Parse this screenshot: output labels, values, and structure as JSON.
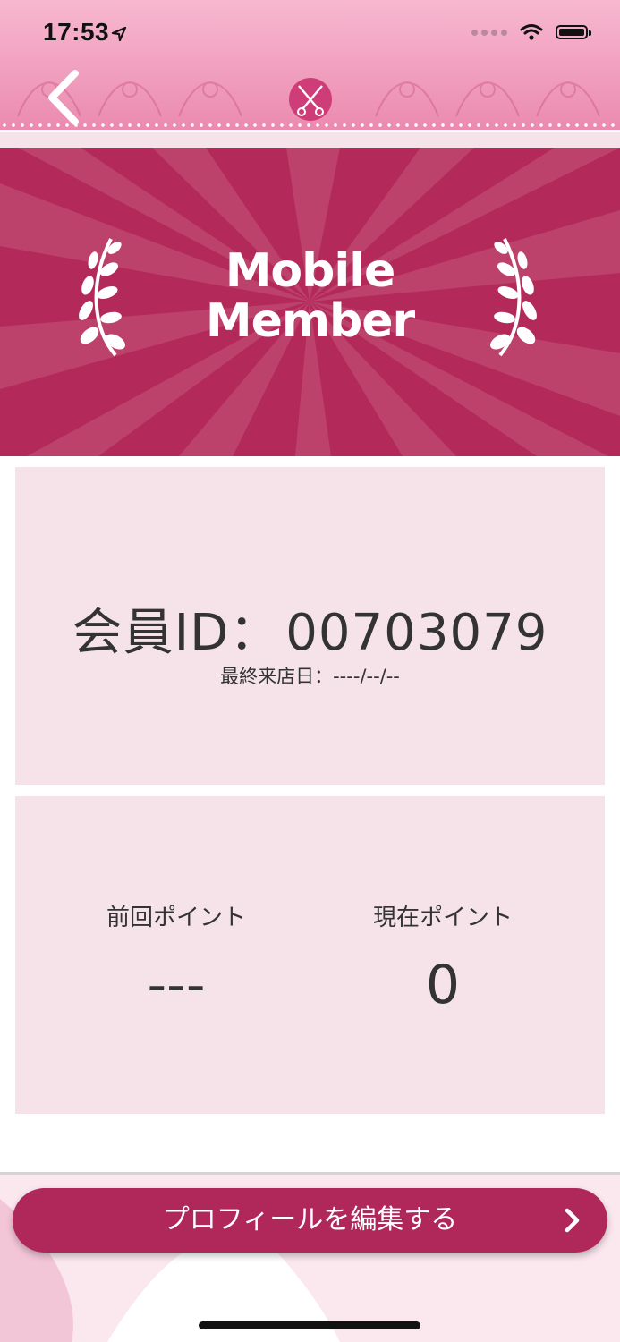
{
  "status_bar": {
    "time": "17:53"
  },
  "header": {
    "back_icon": "chevron-left-icon",
    "logo_icon": "scissors-logo-icon"
  },
  "banner": {
    "title_line1": "Mobile",
    "title_line2": "Member"
  },
  "member": {
    "id_label": "会員ID：",
    "id_value": "00703079",
    "last_visit_label": "最終来店日：",
    "last_visit_value": "----/--/--"
  },
  "points": {
    "previous_label": "前回ポイント",
    "previous_value": "---",
    "current_label": "現在ポイント",
    "current_value": "0"
  },
  "actions": {
    "edit_profile_label": "プロフィールを編集する"
  },
  "colors": {
    "accent": "#b0285a",
    "card_bg": "#f6e3ea",
    "header_pink": "#f2a3c1",
    "banner": "#b32a5a"
  }
}
